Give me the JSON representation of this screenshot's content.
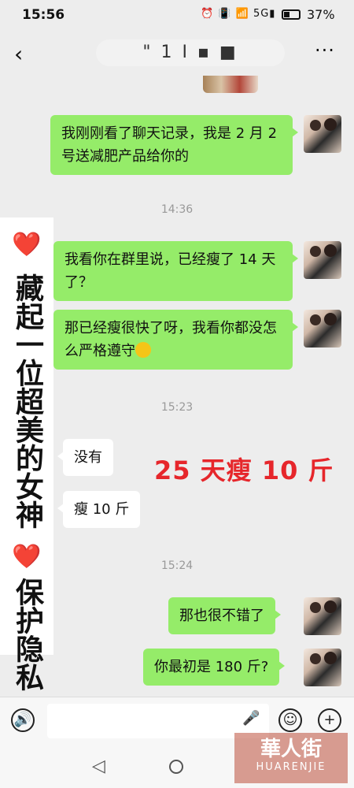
{
  "status_bar": {
    "time": "15:56",
    "icons_text": "⏰ 📳 📶 5G▮",
    "battery_percent": "37%",
    "battery_level": 0.37
  },
  "header": {
    "back_icon": "‹",
    "title": "\" 1 I ▪ ■",
    "more_icon": "···"
  },
  "messages": [
    {
      "side": "out",
      "text": "我刚刚看了聊天记录，我是 2 月 2 号送减肥产品给你的"
    },
    {
      "type": "time",
      "text": "14:36"
    },
    {
      "side": "out",
      "text": "我看你在群里说，已经瘦了 14 天了？"
    },
    {
      "side": "out",
      "text": "那已经瘦很快了呀，我看你都没怎么严格遵守"
    },
    {
      "type": "time",
      "text": "15:23"
    },
    {
      "side": "in",
      "text": "没有"
    },
    {
      "side": "in",
      "text": "瘦 10 斤"
    },
    {
      "type": "time",
      "text": "15:24"
    },
    {
      "side": "out",
      "text": "那也很不错了"
    },
    {
      "side": "out",
      "text": "你最初是 180 斤?"
    }
  ],
  "side_banner": {
    "heart": "❤️",
    "text_1": "藏起一位超美的女神",
    "text_2": "保护隐私"
  },
  "promo_text": "25 天瘦 10 斤",
  "input_bar": {
    "voice_icon": "voice-icon",
    "emoji_icon": "emoji-icon",
    "add_icon": "plus-icon"
  },
  "watermark": {
    "line1": "華人街",
    "line2": "HUARENJIE"
  },
  "colors": {
    "out_bubble": "#95ec69",
    "in_bubble": "#ffffff",
    "background": "#ededed",
    "promo_red": "#e6262b"
  }
}
